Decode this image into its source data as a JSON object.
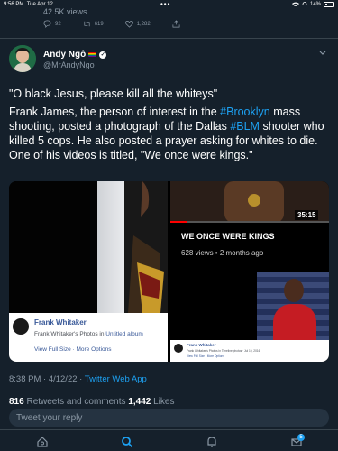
{
  "status_bar": {
    "time": "9:56 PM",
    "date": "Tue Apr 12",
    "dots": "•••",
    "battery_percent": "14%"
  },
  "previous_tweet": {
    "views": "42.5K views",
    "replies": "92",
    "retweets": "619",
    "likes": "1,282"
  },
  "author": {
    "name": "Andy Ngô",
    "handle": "@MrAndyNgo"
  },
  "tweet": {
    "quote": "\"O black Jesus, please kill all the whiteys\"",
    "body_part1": "Frank James, the person of interest in the ",
    "hashtag1": "#Brooklyn",
    "body_part2": " mass shooting, posted a photograph of the Dallas ",
    "hashtag2": "#BLM",
    "body_part3": " shooter who killed 5 cops. He also posted a prayer asking for whites to die. One of his videos is titled, \"We once were kings.\""
  },
  "media": {
    "fb_card": {
      "name": "Frank Whitaker",
      "subtitle_prefix": "Frank Whitaker's Photos in ",
      "subtitle_album": "Untitled album",
      "links": "View Full Size · More Options"
    },
    "yt_card": {
      "duration": "35:15",
      "title": "WE ONCE WERE KINGS",
      "meta": "628 views • 2 months ago",
      "progress_fraction": 0.1
    },
    "mini_card": {
      "name": "Frank Whitaker",
      "subtitle": "Frank Whitaker's Photos in Timeline photos · Jul 19, 2016",
      "links": "View Full Size · More Options"
    }
  },
  "meta": {
    "timestamp": "8:38 PM · 4/12/22 · ",
    "app": "Twitter Web App"
  },
  "stats": {
    "retweets_count": "816",
    "retweets_label": " Retweets and comments ",
    "likes_count": "1,442",
    "likes_label": " Likes"
  },
  "reply": {
    "placeholder": "Tweet your reply"
  },
  "tabbar": {
    "notifications_badge": "5"
  },
  "colors": {
    "background": "#15202b",
    "accent": "#1da1f2",
    "muted": "#8b98a5"
  }
}
